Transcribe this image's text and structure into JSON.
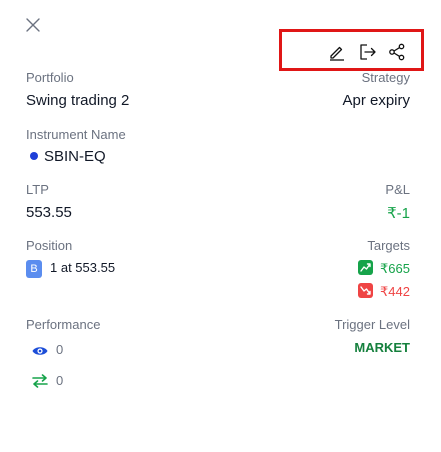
{
  "header": {
    "close_icon": "close-icon",
    "actions": [
      {
        "name": "edit",
        "icon": "pencil-icon"
      },
      {
        "name": "exit",
        "icon": "exit-arrow-icon"
      },
      {
        "name": "share",
        "icon": "share-icon"
      }
    ],
    "highlight_color": "#e01616"
  },
  "portfolio": {
    "label": "Portfolio",
    "value": "Swing trading 2"
  },
  "strategy": {
    "label": "Strategy",
    "value": "Apr expiry"
  },
  "instrument": {
    "label": "Instrument Name",
    "value": "SBIN-EQ",
    "dot_color": "#1e3fd8"
  },
  "ltp": {
    "label": "LTP",
    "value": "553.55"
  },
  "pnl": {
    "label": "P&L",
    "value": "₹-1",
    "color": "#16a34a"
  },
  "position": {
    "label": "Position",
    "side": "B",
    "text": "1 at 553.55"
  },
  "targets": {
    "label": "Targets",
    "up": {
      "value": "₹665",
      "color": "#16a34a",
      "icon": "trend-up-icon"
    },
    "down": {
      "value": "₹442",
      "color": "#ef4444",
      "icon": "trend-down-icon"
    }
  },
  "performance": {
    "label": "Performance",
    "views": {
      "icon": "eye-icon",
      "count": "0"
    },
    "trades": {
      "icon": "swap-icon",
      "count": "0"
    }
  },
  "trigger": {
    "label": "Trigger Level",
    "value": "MARKET"
  }
}
